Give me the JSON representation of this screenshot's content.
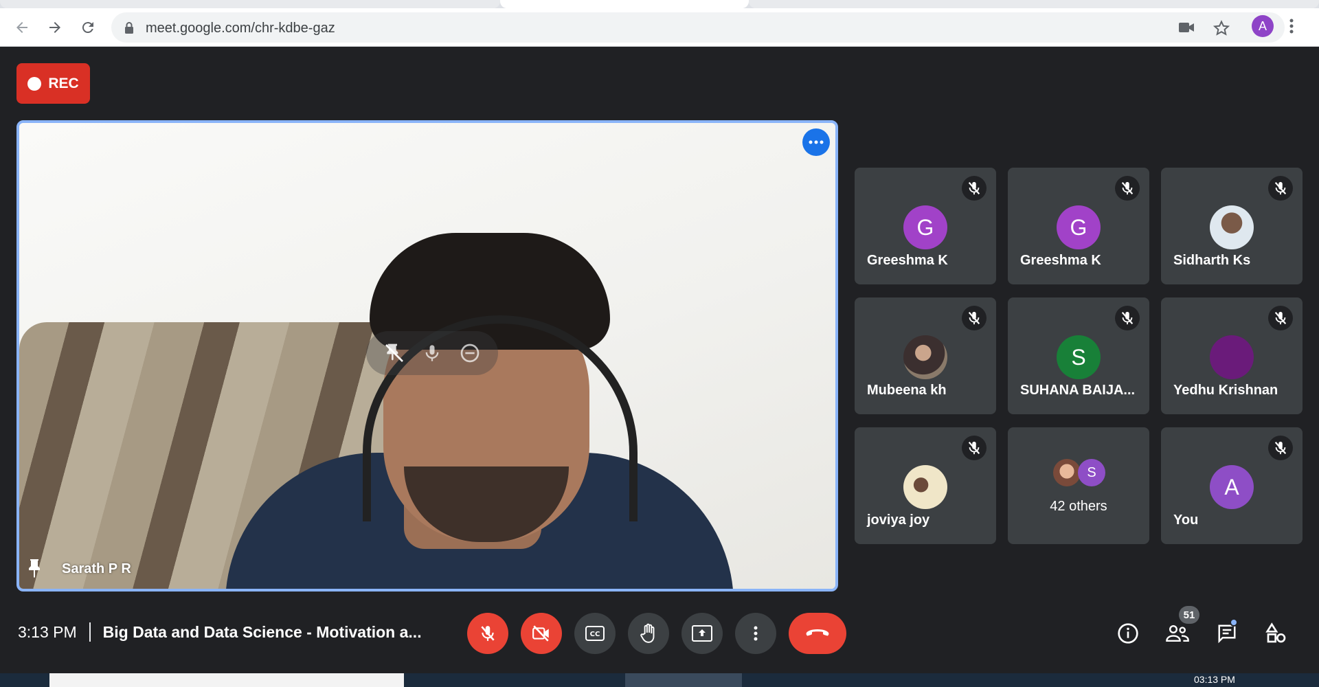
{
  "browser": {
    "url": "meet.google.com/chr-kdbe-gaz",
    "profile_initial": "A"
  },
  "recording": {
    "label": "REC"
  },
  "main": {
    "name": "Sarath P R"
  },
  "participants": [
    {
      "name": "Greeshma K",
      "initial": "G",
      "color": "#a142c8"
    },
    {
      "name": "Greeshma K",
      "initial": "G",
      "color": "#a142c8"
    },
    {
      "name": "Sidharth Ks",
      "initial": "",
      "color": "#c9d6e0"
    },
    {
      "name": "Mubeena kh",
      "initial": "",
      "color": "#5a4a4a"
    },
    {
      "name": "SUHANA BAIJA...",
      "initial": "S",
      "color": "#188038"
    },
    {
      "name": "Yedhu Krishnan",
      "initial": "",
      "color": "#6a1b7a"
    },
    {
      "name": "joviya joy",
      "initial": "",
      "color": "#e8dcc0"
    },
    {
      "name": "42 others",
      "initial": "S",
      "color": "#8e4ec6"
    },
    {
      "name": "You",
      "initial": "A",
      "color": "#8e4ec6"
    }
  ],
  "bottom": {
    "time": "3:13 PM",
    "meeting_title": "Big Data and Data Science - Motivation a...",
    "participant_count": "51"
  },
  "taskbar": {
    "clock": "03:13 PM"
  }
}
